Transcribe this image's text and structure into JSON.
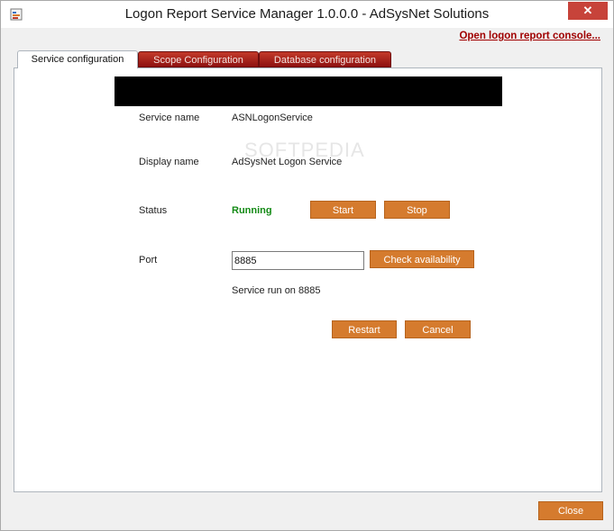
{
  "window": {
    "title": "Logon Report Service Manager 1.0.0.0 - AdSysNet Solutions",
    "close_glyph": "✕"
  },
  "header": {
    "console_link": "Open logon report console..."
  },
  "tabs": [
    {
      "label": "Service configuration",
      "active": true
    },
    {
      "label": "Scope Configuration",
      "active": false
    },
    {
      "label": "Database configuration",
      "active": false
    }
  ],
  "service": {
    "name_label": "Service name",
    "name_value": "ASNLogonService",
    "display_label": "Display name",
    "display_value": "AdSysNet Logon Service",
    "status_label": "Status",
    "status_value": "Running",
    "start_label": "Start",
    "stop_label": "Stop",
    "port_label": "Port",
    "port_value": "8885",
    "check_label": "Check availability",
    "run_message": "Service run on 8885",
    "restart_label": "Restart",
    "cancel_label": "Cancel"
  },
  "watermark": "SOFTPEDIA",
  "footer": {
    "close_label": "Close"
  },
  "colors": {
    "accent_button": "#d57b2e",
    "tab_red": "#a12318",
    "status_green": "#138a15",
    "link_red": "#a00000"
  }
}
